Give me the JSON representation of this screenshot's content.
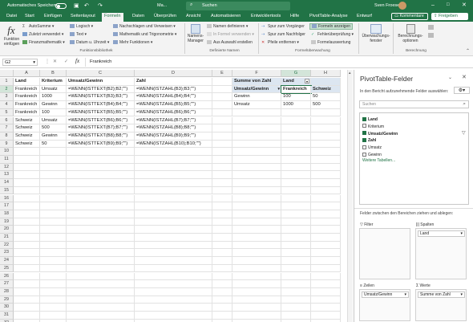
{
  "titlebar": {
    "autosave": "Automatisches Speichern",
    "filename": "Ma...",
    "search": "Suchen",
    "user": "Sven Froese"
  },
  "menu": {
    "tabs": [
      "Datei",
      "Start",
      "Einfügen",
      "Seitenlayout",
      "Formeln",
      "Daten",
      "Überprüfen",
      "Ansicht",
      "Automatisieren",
      "Entwicklertools",
      "Hilfe",
      "PivotTable-Analyse",
      "Entwurf"
    ],
    "active": "Formeln",
    "comments": "Kommentare",
    "share": "Freigeben"
  },
  "ribbon": {
    "insert_function": "Funktion einfügen",
    "autosum": "AutoSumme",
    "recent": "Zuletzt verwendet",
    "financial": "Finanzmathematik",
    "logical": "Logisch",
    "text": "Text",
    "datetime": "Datum u. Uhrzeit",
    "lookup": "Nachschlagen und Verweisen",
    "math": "Mathematik und Trigonometrie",
    "more": "Mehr Funktionen",
    "library_group": "Funktionsbibliothek",
    "name_manager": "Namens-Manager",
    "define_name": "Namen definieren",
    "in_formula": "In Formel verwenden",
    "from_selection": "Aus Auswahl erstellen",
    "names_group": "Definierte Namen",
    "trace_prec": "Spur zum Vorgänger",
    "trace_dep": "Spur zum Nachfolger",
    "remove_arrows": "Pfeile entfernen",
    "show_formulas": "Formeln anzeigen",
    "error_check": "Fehlerüberprüfung",
    "eval_formula": "Formelauswertung",
    "audit_group": "Formelüberwachung",
    "watch": "Überwachungs-fenster",
    "calc_options": "Berechnungs-optionen",
    "calc_group": "Berechnung"
  },
  "formula_bar": {
    "name_box": "G2",
    "fx": "fx",
    "content": "Frankreich"
  },
  "columns": [
    "A",
    "B",
    "C",
    "D",
    "E",
    "F",
    "G",
    "H"
  ],
  "rows": [
    "1",
    "2",
    "3",
    "4",
    "5",
    "6",
    "7",
    "8",
    "9",
    "10",
    "11",
    "12",
    "13",
    "14",
    "15",
    "16",
    "17",
    "18",
    "19",
    "20",
    "21",
    "22",
    "23",
    "24",
    "25",
    "26",
    "27",
    "28",
    "29",
    "30",
    "31",
    "32"
  ],
  "cells": {
    "A": [
      "Land",
      "Frankreich",
      "Frankreich",
      "Frankreich",
      "Frankreich",
      "Schweiz",
      "Schweiz",
      "Schweiz",
      "Schweiz"
    ],
    "B": [
      "Kriterium",
      "Umsatz",
      "1000",
      "Gewinn",
      "100",
      "Umsatz",
      "500",
      "Gewinn",
      "50"
    ],
    "C": [
      "Umsatz/Gewinn",
      "=WENN(ISTTEXT(B2);B2;\"\")",
      "=WENN(ISTTEXT(B3);B3;\"\")",
      "=WENN(ISTTEXT(B4);B4;\"\")",
      "=WENN(ISTTEXT(B5);B5;\"\")",
      "=WENN(ISTTEXT(B6);B6;\"\")",
      "=WENN(ISTTEXT(B7);B7;\"\")",
      "=WENN(ISTTEXT(B8);B8;\"\")",
      "=WENN(ISTTEXT(B9);B9;\"\")"
    ],
    "D": [
      "Zahl",
      "=WENN(ISTZAHL(B3);B3;\"\")",
      "=WENN(ISTZAHL(B4);B4;\"\")",
      "=WENN(ISTZAHL(B5);B5;\"\")",
      "=WENN(ISTZAHL(B6);B6;\"\")",
      "=WENN(ISTZAHL(B7);B7;\"\")",
      "=WENN(ISTZAHL(B8);B8;\"\")",
      "=WENN(ISTZAHL(B9);B9;\"\")",
      "=WENN(ISTZAHL(B10);B10;\"\")"
    ]
  },
  "pivot": {
    "sum_label": "Summe von Zahl",
    "col_label": "Land",
    "row_label": "Umsatz/Gewinn",
    "col1": "Frankreich",
    "col2": "Schweiz",
    "r1": "Gewinn",
    "r1c1": "100",
    "r1c2": "50",
    "r2": "Umsatz",
    "r2c1": "1000",
    "r2c2": "500"
  },
  "panel": {
    "title": "PivotTable-Felder",
    "choose": "In den Bericht aufzunehmende Felder auswählen:",
    "search": "Suchen",
    "fields": [
      {
        "name": "Land",
        "checked": true
      },
      {
        "name": "Kriterium",
        "checked": false
      },
      {
        "name": "Umsatz/Gewinn",
        "checked": true
      },
      {
        "name": "Zahl",
        "checked": true
      },
      {
        "name": "Umsatz",
        "checked": false
      },
      {
        "name": "Gewinn",
        "checked": false
      }
    ],
    "more_tables": "Weitere Tabellen...",
    "drag": "Felder zwischen den Bereichen ziehen und ablegen:",
    "filter": "Filter",
    "columns": "Spalten",
    "rows": "Zeilen",
    "values": "Werte",
    "col_chip": "Land",
    "row_chip": "Umsatz/Gewinn",
    "val_chip": "Summe von Zahl"
  },
  "colors": {
    "excel_green": "#217346",
    "pivot_header": "#dce6f1"
  }
}
